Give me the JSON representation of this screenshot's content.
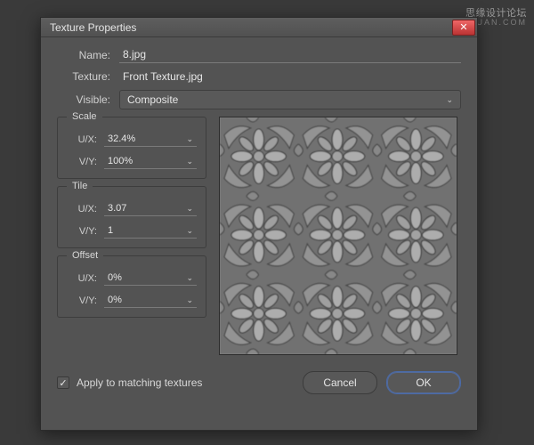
{
  "watermark_top": "思缘设计论坛",
  "watermark_site": "WWW.MISSYUAN.COM",
  "dialog": {
    "title": "Texture Properties",
    "name_label": "Name:",
    "name_value": "8.jpg",
    "texture_label": "Texture:",
    "texture_value": "Front Texture.jpg",
    "visible_label": "Visible:",
    "visible_value": "Composite"
  },
  "groups": {
    "scale": {
      "title": "Scale",
      "ux_label": "U/X:",
      "ux_value": "32.4%",
      "vy_label": "V/Y:",
      "vy_value": "100%"
    },
    "tile": {
      "title": "Tile",
      "ux_label": "U/X:",
      "ux_value": "3.07",
      "vy_label": "V/Y:",
      "vy_value": "1"
    },
    "offset": {
      "title": "Offset",
      "ux_label": "U/X:",
      "ux_value": "0%",
      "vy_label": "V/Y:",
      "vy_value": "0%"
    }
  },
  "apply_checkbox": {
    "checked": true,
    "label": "Apply to matching textures"
  },
  "buttons": {
    "cancel": "Cancel",
    "ok": "OK"
  }
}
